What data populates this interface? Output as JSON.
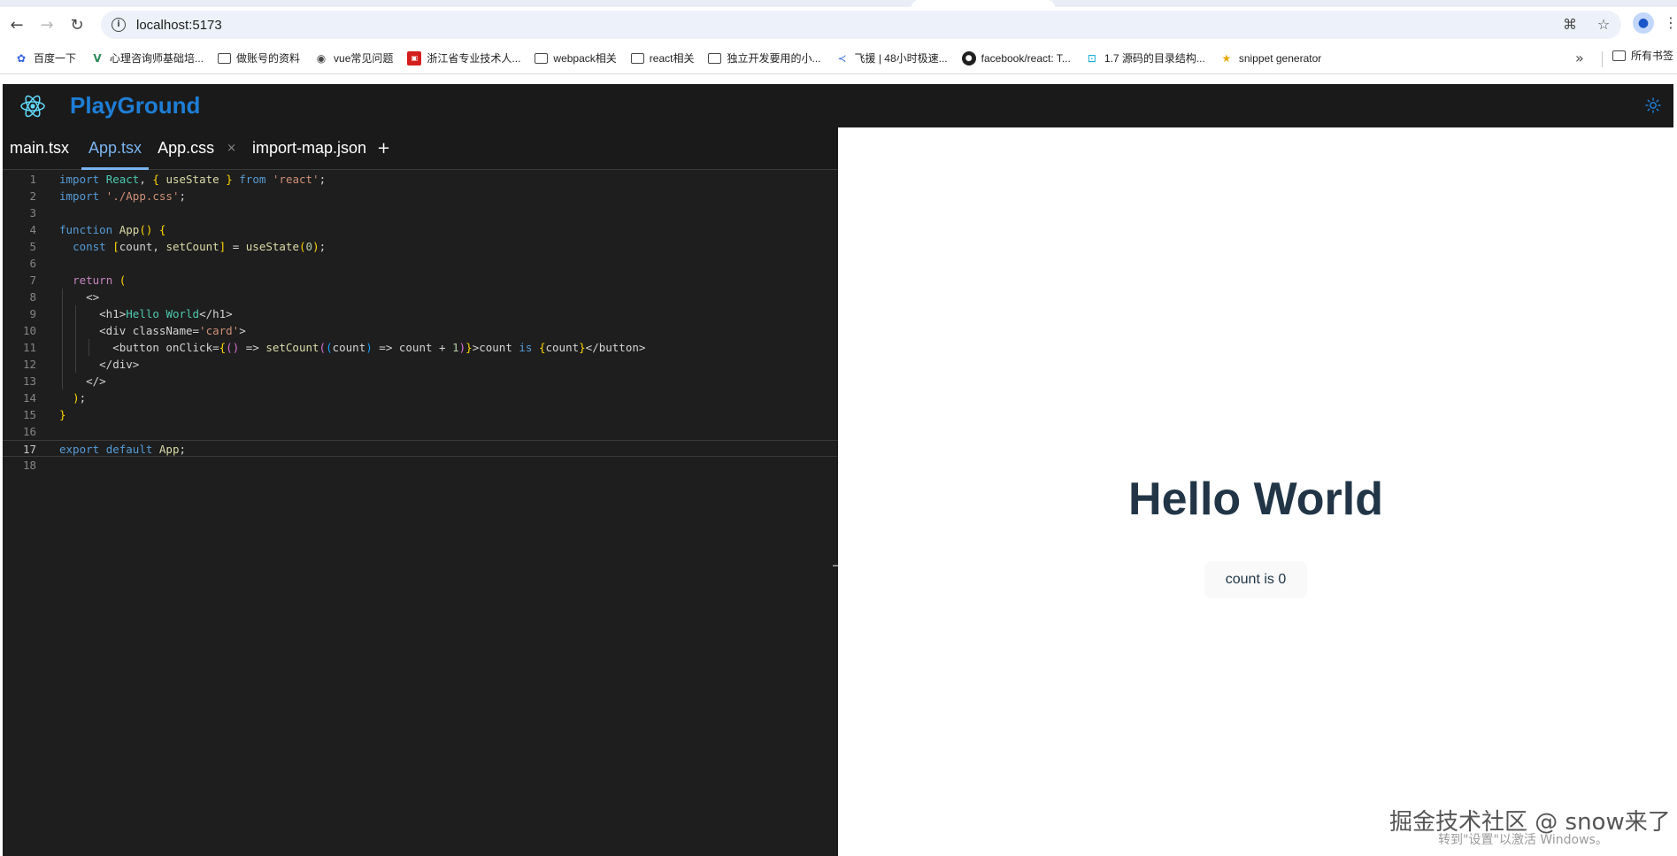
{
  "browser": {
    "url": "localhost:5173",
    "bookmarks": [
      {
        "label": "百度一下",
        "icon": "baidu-icon"
      },
      {
        "label": "心理咨询师基础培...",
        "icon": "vue-icon"
      },
      {
        "label": "做账号的资料",
        "icon": "folder-icon"
      },
      {
        "label": "vue常见问题",
        "icon": "globe-icon"
      },
      {
        "label": "浙江省专业技术人...",
        "icon": "red-badge-icon"
      },
      {
        "label": "webpack相关",
        "icon": "folder-icon"
      },
      {
        "label": "react相关",
        "icon": "folder-icon"
      },
      {
        "label": "独立开发要用的小...",
        "icon": "folder-icon"
      },
      {
        "label": "飞援 | 48小时极速...",
        "icon": "folder-icon"
      },
      {
        "label": "facebook/react: T...",
        "icon": "github-icon"
      },
      {
        "label": "1.7 源码的目录结构...",
        "icon": "bilibili-icon"
      },
      {
        "label": "snippet generator",
        "icon": "star-badge-icon"
      }
    ],
    "more_label": "»",
    "all_bookmarks_label": "所有书签"
  },
  "app": {
    "title": "PlayGround",
    "tabs": [
      {
        "label": "main.tsx",
        "active": false,
        "closable": false
      },
      {
        "label": "App.tsx",
        "active": true,
        "closable": false
      },
      {
        "label": "App.css",
        "active": false,
        "closable": true
      },
      {
        "label": "import-map.json",
        "active": false,
        "closable": false
      }
    ],
    "add_tab_label": "+",
    "current_line": 17
  },
  "code_lines": [
    "import React, { useState } from 'react';",
    "import './App.css';",
    "",
    "function App() {",
    "  const [count, setCount] = useState(0);",
    "",
    "  return (",
    "    <>",
    "      <h1>Hello World</h1>",
    "      <div className='card'>",
    "        <button onClick={() => setCount((count) => count + 1)}>count is {count}</button>",
    "      </div>",
    "    </>",
    "  );",
    "}",
    "",
    "export default App;",
    ""
  ],
  "preview": {
    "heading": "Hello World",
    "button_label": "count is 0"
  },
  "watermark": {
    "main": "掘金技术社区 @ snow来了",
    "sub": "转到\"设置\"以激活 Windows。"
  },
  "colors": {
    "accent": "#1e7ed6",
    "tab_active": "#7ab4f0",
    "editor_bg": "#1e1e1e",
    "header_bg": "#1a1a1a",
    "heading_text": "#213547"
  }
}
